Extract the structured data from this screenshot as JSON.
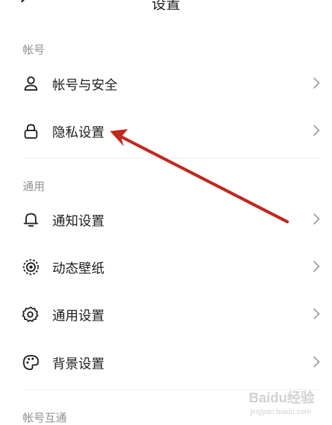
{
  "header": {
    "title": "设置",
    "back_icon": "chevron-left-icon"
  },
  "sections": [
    {
      "title": "帐号",
      "items": [
        {
          "label": "帐号与安全",
          "icon": "person-icon"
        },
        {
          "label": "隐私设置",
          "icon": "lock-icon"
        }
      ]
    },
    {
      "title": "通用",
      "items": [
        {
          "label": "通知设置",
          "icon": "bell-icon"
        },
        {
          "label": "动态壁纸",
          "icon": "dynamic-wallpaper-icon"
        },
        {
          "label": "通用设置",
          "icon": "gear-icon"
        },
        {
          "label": "背景设置",
          "icon": "palette-icon"
        }
      ]
    },
    {
      "title": "帐号互通",
      "items": []
    }
  ],
  "annotation": {
    "color": "#c0291e",
    "target": "隐私设置"
  },
  "watermark": {
    "main": "Baidu经验",
    "sub": "jingyan.baidu.com"
  },
  "colors": {
    "section_header": "#8e8e8e",
    "text": "#1e1e1e",
    "chevron": "#9a9a9a",
    "divider": "#ececec"
  }
}
